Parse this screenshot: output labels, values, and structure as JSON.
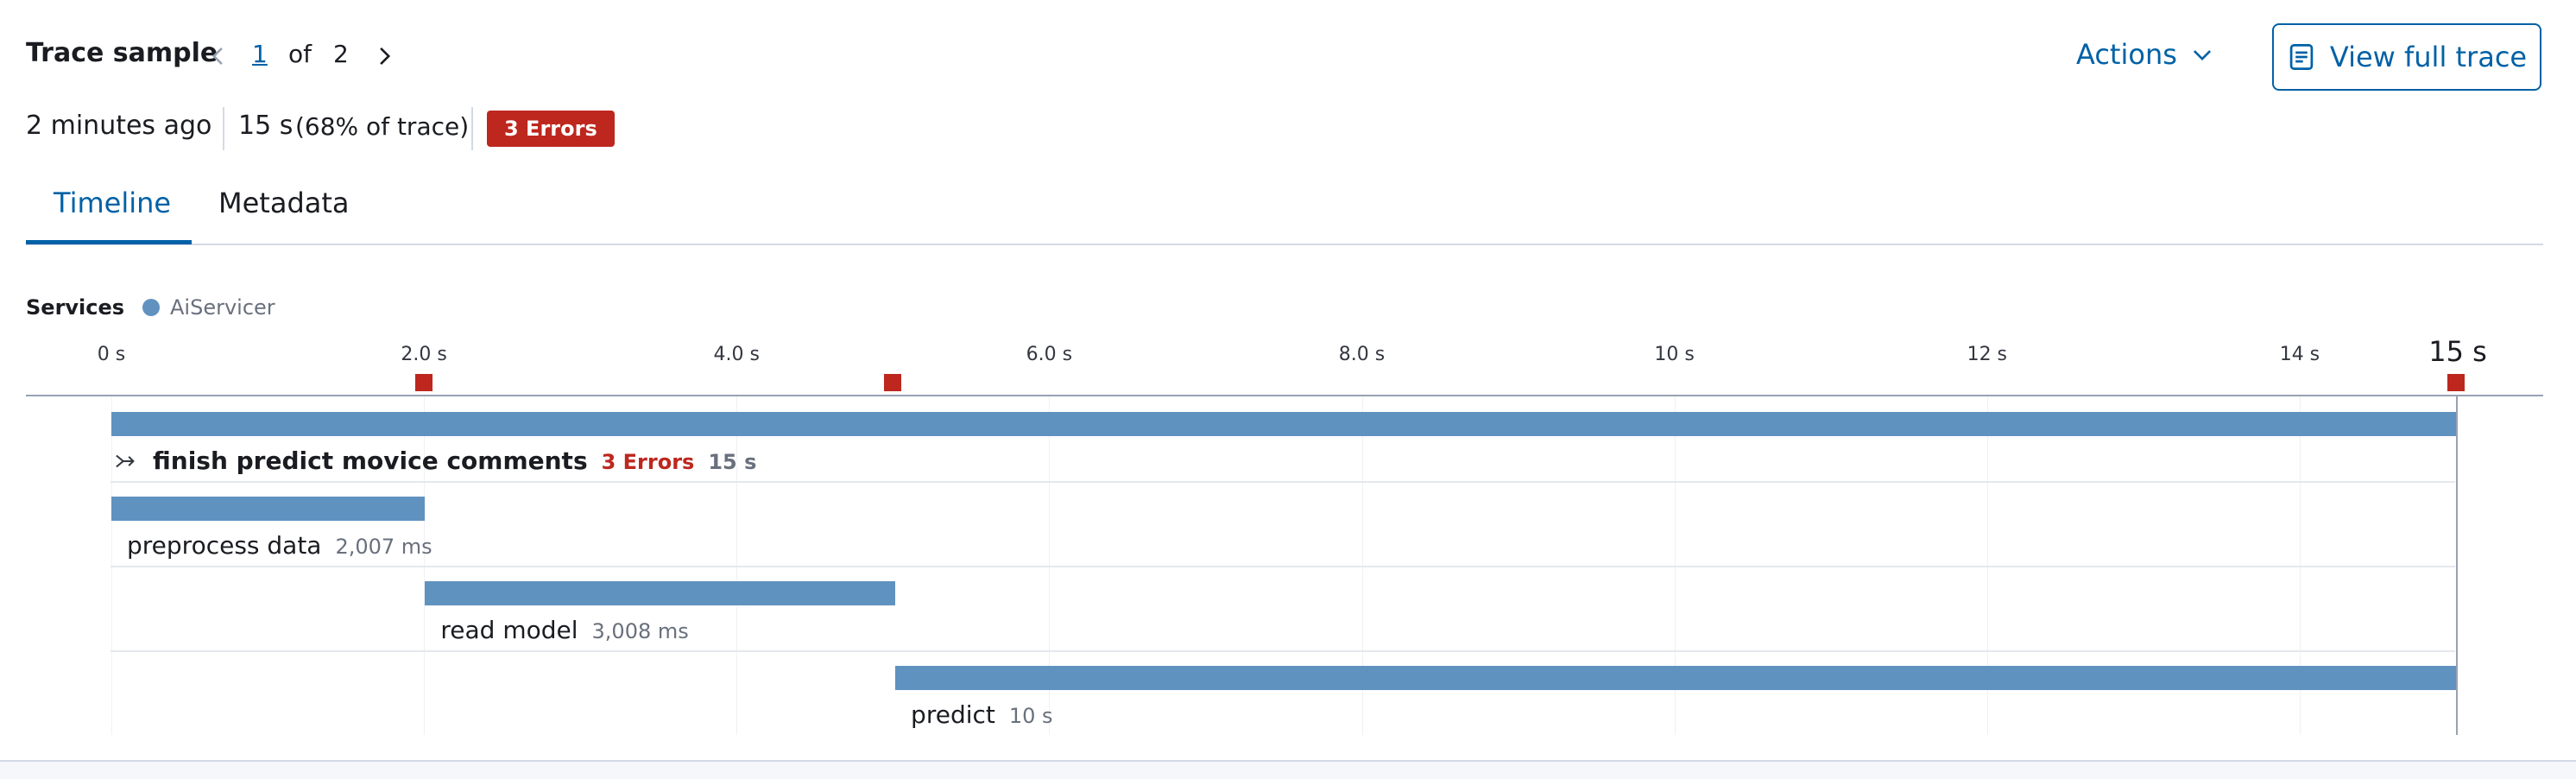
{
  "header": {
    "title": "Trace sample",
    "page_current": "1",
    "page_of": "of",
    "page_total": "2",
    "actions_label": "Actions",
    "view_full_trace_label": "View full trace"
  },
  "meta": {
    "time_ago": "2 minutes ago",
    "duration": "15 s",
    "duration_pct": "(68% of trace)",
    "errors_badge": "3 Errors"
  },
  "tabs": [
    {
      "label": "Timeline",
      "active": true
    },
    {
      "label": "Metadata",
      "active": false
    }
  ],
  "services": {
    "label": "Services",
    "items": [
      {
        "name": "AiServicer",
        "color": "#6092c0"
      }
    ]
  },
  "timeline": {
    "ticks": [
      "0 s",
      "2.0 s",
      "4.0 s",
      "6.0 s",
      "8.0 s",
      "10 s",
      "12 s",
      "14 s"
    ],
    "end_tick": "15 s",
    "max_seconds": 15,
    "error_marks_seconds": [
      2.0,
      5.0,
      15.0
    ],
    "spans": [
      {
        "name": "finish predict movice comments",
        "errors": "3 Errors",
        "duration": "15 s",
        "start": 0,
        "length": 15,
        "bold": true,
        "icon": "merge-icon"
      },
      {
        "name": "preprocess data",
        "duration": "2,007 ms",
        "start": 0,
        "length": 2.007
      },
      {
        "name": "read model",
        "duration": "3,008 ms",
        "start": 2.007,
        "length": 3.008
      },
      {
        "name": "predict",
        "duration": "10 s",
        "start": 5.015,
        "length": 9.985
      }
    ]
  },
  "colors": {
    "accent": "#0061a6",
    "error": "#bd271e",
    "bar": "#6092c0"
  }
}
